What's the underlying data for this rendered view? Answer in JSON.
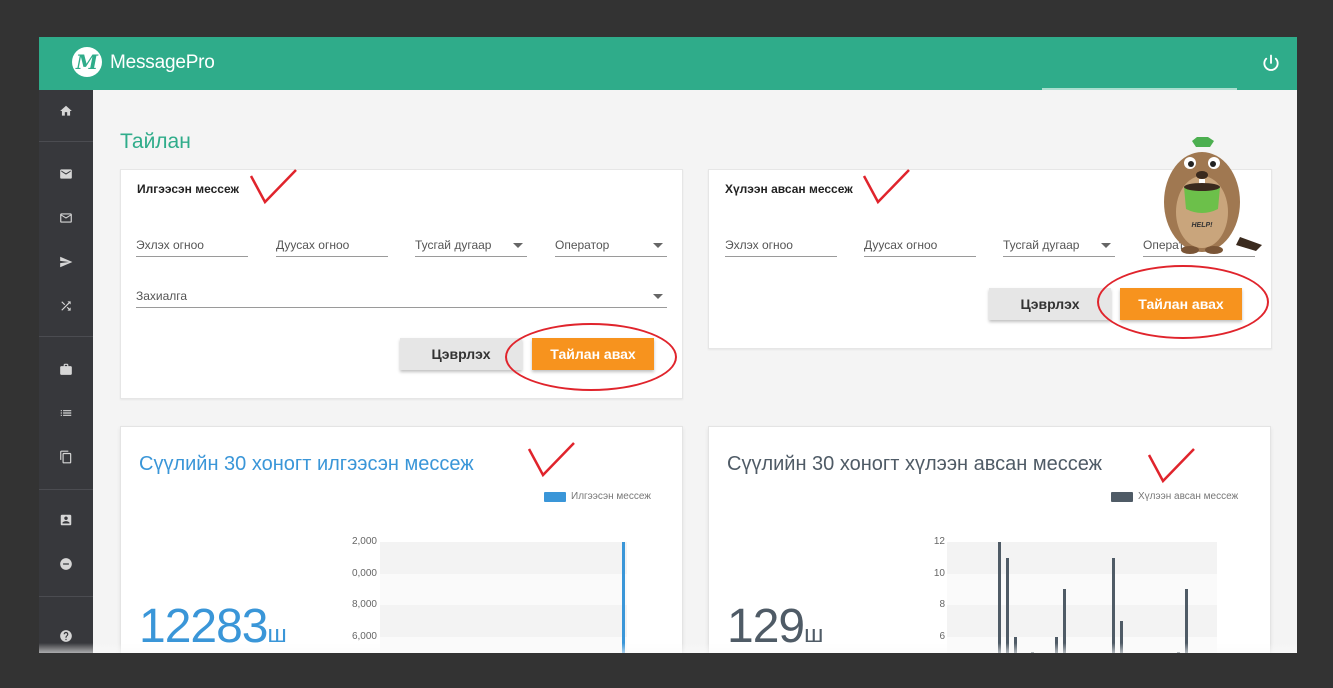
{
  "app": {
    "brand": "MessagePro",
    "logo_letter": "M",
    "accent": "#2fac8a"
  },
  "page": {
    "title": "Тайлан"
  },
  "sent_filter": {
    "title": "Илгээсэн мессеж",
    "start_date": "Эхлэх огноо",
    "end_date": "Дуусах огноо",
    "special_number": "Тусгай дугаар",
    "operator": "Оператор",
    "order": "Захиалга",
    "clear_label": "Цэврлэх",
    "report_label": "Тайлан авах"
  },
  "received_filter": {
    "title": "Хүлээн авсан мессеж",
    "start_date": "Эхлэх огноо",
    "end_date": "Дуусах огноо",
    "special_number": "Тусгай дугаар",
    "operator": "Оператор",
    "clear_label": "Цэврлэх",
    "report_label": "Тайлан авах"
  },
  "sent_chart": {
    "title": "Сүүлийн 30 хоногт илгээсэн мессеж",
    "legend": "Илгээсэн мессеж",
    "total": "12283",
    "unit": "ш",
    "color": "#3a96d8"
  },
  "received_chart": {
    "title": "Сүүлийн 30 хоногт хүлээн авсан мессеж",
    "legend": "Хүлээн авсан мессеж",
    "total": "129",
    "unit": "ш",
    "color": "#4f5b66"
  },
  "mascot": {
    "sign": "HELP!"
  },
  "sidebar": {
    "icons": [
      "home-icon",
      "inbox-icon",
      "mail-icon",
      "send-icon",
      "shuffle-icon",
      "briefcase-icon",
      "list-icon",
      "copy-icon",
      "contact-icon",
      "block-icon",
      "help-icon"
    ]
  },
  "chart_data": [
    {
      "type": "bar",
      "title": "Сүүлийн 30 хоногт илгээсэн мессеж",
      "series": [
        {
          "name": "Илгээсэн мессеж",
          "values": [
            0,
            0,
            0,
            0,
            0,
            0,
            0,
            0,
            0,
            0,
            0,
            0,
            0,
            0,
            0,
            0,
            0,
            0,
            0,
            0,
            0,
            0,
            0,
            0,
            0,
            0,
            0,
            0,
            12100,
            0
          ]
        }
      ],
      "yticks": [
        "2,000",
        "0,000",
        "8,000",
        "6,000"
      ],
      "ytick_values": [
        12000,
        10000,
        8000,
        6000
      ],
      "ylim": [
        6000,
        12000
      ],
      "total": 12283,
      "legend": "top-right"
    },
    {
      "type": "bar",
      "title": "Сүүлийн 30 хоногт хүлээн авсан мессеж",
      "series": [
        {
          "name": "Хүлээн авсан мессеж",
          "values": [
            0,
            0,
            0,
            0,
            0,
            0,
            12,
            11,
            6,
            0,
            5,
            0,
            0,
            6,
            9,
            0,
            0,
            0,
            0,
            0,
            11,
            7,
            0,
            0,
            0,
            0,
            0,
            0,
            5,
            9
          ]
        }
      ],
      "yticks": [
        "12",
        "10",
        "8",
        "6"
      ],
      "ytick_values": [
        12,
        10,
        8,
        6
      ],
      "ylim": [
        6,
        12
      ],
      "total": 129,
      "legend": "top-right"
    }
  ]
}
